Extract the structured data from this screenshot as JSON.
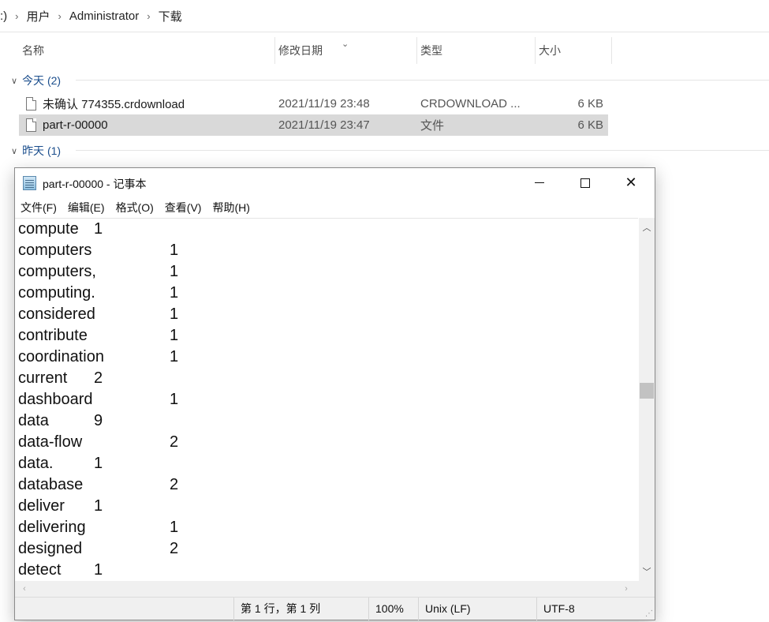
{
  "explorer": {
    "breadcrumb": [
      ":)",
      "用户",
      "Administrator",
      "下载"
    ],
    "columns": {
      "name": "名称",
      "date": "修改日期",
      "type": "类型",
      "size": "大小"
    },
    "groups": [
      {
        "label": "今天 (2)"
      },
      {
        "label": "昨天 (1)"
      }
    ],
    "files": [
      {
        "name": "未确认 774355.crdownload",
        "date": "2021/11/19 23:48",
        "type": "CRDOWNLOAD ...",
        "size": "6 KB"
      },
      {
        "name": "part-r-00000",
        "date": "2021/11/19 23:47",
        "type": "文件",
        "size": "6 KB"
      }
    ]
  },
  "notepad": {
    "title": "part-r-00000 - 记事本",
    "menu": [
      "文件(F)",
      "编辑(E)",
      "格式(O)",
      "查看(V)",
      "帮助(H)"
    ],
    "lines": [
      {
        "word": "compute",
        "count": "1"
      },
      {
        "word": "computers",
        "count": "1"
      },
      {
        "word": "computers,",
        "count": "1"
      },
      {
        "word": "computing.",
        "count": "1"
      },
      {
        "word": "considered",
        "count": "1"
      },
      {
        "word": "contribute",
        "count": "1"
      },
      {
        "word": "coordination",
        "count": "1"
      },
      {
        "word": "current",
        "count": "2"
      },
      {
        "word": "dashboard",
        "count": "1"
      },
      {
        "word": "data",
        "count": "9"
      },
      {
        "word": "data-flow",
        "count": "2"
      },
      {
        "word": "data.",
        "count": "1"
      },
      {
        "word": "database",
        "count": "2"
      },
      {
        "word": "deliver",
        "count": "1"
      },
      {
        "word": "delivering",
        "count": "1"
      },
      {
        "word": "designed",
        "count": "2"
      },
      {
        "word": "detect",
        "count": "1"
      }
    ],
    "status": {
      "position": "第 1 行，第 1 列",
      "zoom": "100%",
      "line_ending": "Unix (LF)",
      "encoding": "UTF-8"
    },
    "icons": {
      "minimize": "minimize-icon",
      "maximize": "maximize-icon",
      "close": "close-icon"
    }
  }
}
